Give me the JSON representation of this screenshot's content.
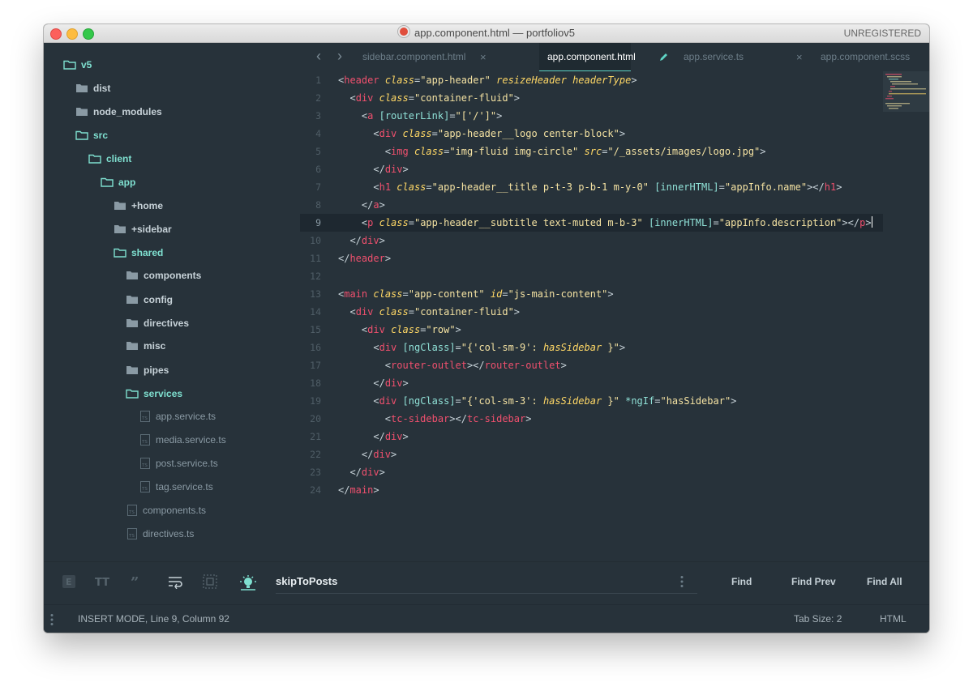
{
  "window": {
    "title": "app.component.html — portfoliov5",
    "badge": "UNREGISTERED"
  },
  "sidebar": {
    "items": [
      {
        "label": "v5",
        "kind": "folder-open"
      },
      {
        "label": "dist",
        "kind": "folder"
      },
      {
        "label": "node_modules",
        "kind": "folder"
      },
      {
        "label": "src",
        "kind": "folder-open"
      },
      {
        "label": "client",
        "kind": "folder-open"
      },
      {
        "label": "app",
        "kind": "folder-open"
      },
      {
        "label": "+home",
        "kind": "folder"
      },
      {
        "label": "+sidebar",
        "kind": "folder"
      },
      {
        "label": "shared",
        "kind": "folder-open"
      },
      {
        "label": "components",
        "kind": "folder"
      },
      {
        "label": "config",
        "kind": "folder"
      },
      {
        "label": "directives",
        "kind": "folder"
      },
      {
        "label": "misc",
        "kind": "folder"
      },
      {
        "label": "pipes",
        "kind": "folder"
      },
      {
        "label": "services",
        "kind": "folder-open"
      },
      {
        "label": "app.service.ts",
        "kind": "file"
      },
      {
        "label": "media.service.ts",
        "kind": "file"
      },
      {
        "label": "post.service.ts",
        "kind": "file"
      },
      {
        "label": "tag.service.ts",
        "kind": "file"
      },
      {
        "label": "components.ts",
        "kind": "file"
      },
      {
        "label": "directives.ts",
        "kind": "file"
      }
    ]
  },
  "tabs": [
    {
      "label": "sidebar.component.html",
      "active": false
    },
    {
      "label": "app.component.html",
      "active": true
    },
    {
      "label": "app.service.ts",
      "active": false
    },
    {
      "label": "app.component.scss",
      "active": false
    }
  ],
  "editor": {
    "active_line": 9,
    "line_numbers": [
      "1",
      "2",
      "3",
      "4",
      "5",
      "6",
      "7",
      "8",
      "9",
      "10",
      "11",
      "12",
      "13",
      "14",
      "15",
      "16",
      "17",
      "18",
      "19",
      "20",
      "21",
      "22",
      "23",
      "24"
    ]
  },
  "find": {
    "query": "skipToPosts",
    "find_label": "Find",
    "find_prev_label": "Find Prev",
    "find_all_label": "Find All"
  },
  "status": {
    "mode": "INSERT MODE, Line 9, Column 92",
    "tab_size": "Tab Size: 2",
    "syntax": "HTML"
  },
  "colors": {
    "accent": "#5fd3c4",
    "background": "#27323a",
    "tag": "#f0506e",
    "attribute": "#ffd866"
  }
}
